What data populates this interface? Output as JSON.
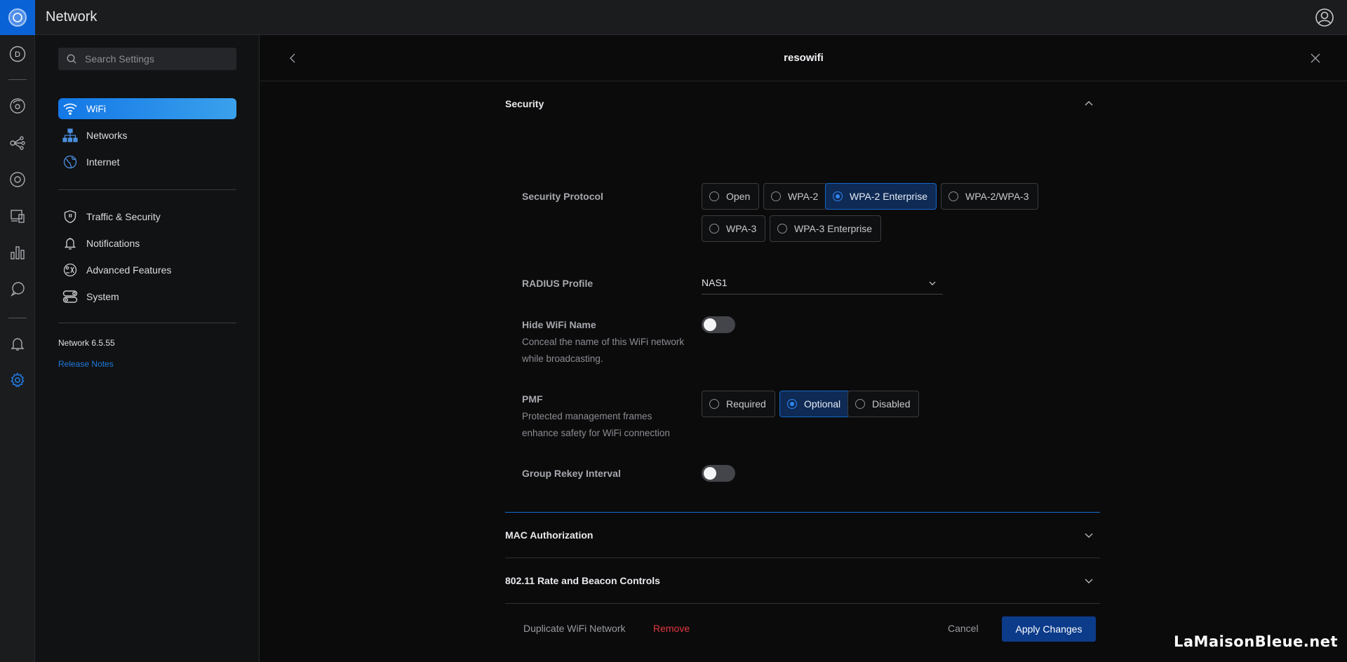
{
  "app": {
    "title": "Network"
  },
  "rail": {
    "items": [
      "dashboard-icon",
      "topology-icon",
      "devices-icon",
      "clients-icon",
      "device-monitor-icon",
      "statistics-icon",
      "insights-icon",
      "alerts-icon",
      "settings-icon"
    ],
    "dashboard_letter": "D"
  },
  "sidebar": {
    "search_placeholder": "Search Settings",
    "items": [
      {
        "label": "WiFi",
        "icon": "wifi-icon",
        "active": true
      },
      {
        "label": "Networks",
        "icon": "networks-icon"
      },
      {
        "label": "Internet",
        "icon": "globe-icon"
      },
      {
        "label": "Traffic & Security",
        "icon": "shield-icon"
      },
      {
        "label": "Notifications",
        "icon": "bell-icon"
      },
      {
        "label": "Advanced Features",
        "icon": "advanced-features-icon"
      },
      {
        "label": "System",
        "icon": "system-icon"
      }
    ],
    "version": "Network 6.5.55",
    "release_notes": "Release Notes"
  },
  "panel": {
    "title": "resowifi",
    "security": {
      "heading": "Security",
      "protocol_label": "Security Protocol",
      "protocol_options": [
        "Open",
        "WPA-2",
        "WPA-2 Enterprise",
        "WPA-2/WPA-3",
        "WPA-3",
        "WPA-3 Enterprise"
      ],
      "protocol_selected": "WPA-2 Enterprise",
      "radius_label": "RADIUS Profile",
      "radius_value": "NAS1",
      "hide_label": "Hide WiFi Name",
      "hide_desc": "Conceal the name of this WiFi network while broadcasting.",
      "hide_enabled": false,
      "pmf_label": "PMF",
      "pmf_desc": "Protected management frames enhance safety for WiFi connection",
      "pmf_options": [
        "Required",
        "Optional",
        "Disabled"
      ],
      "pmf_selected": "Optional",
      "rekey_label": "Group Rekey Interval",
      "rekey_enabled": false
    },
    "mac_heading": "MAC Authorization",
    "rate_heading": "802.11 Rate and Beacon Controls"
  },
  "footer": {
    "duplicate": "Duplicate WiFi Network",
    "remove": "Remove",
    "cancel": "Cancel",
    "apply": "Apply Changes"
  },
  "colors": {
    "accent": "#1377e6",
    "danger": "#e0383e",
    "apply_bg": "#0c3b8a"
  },
  "watermark": "LaMaisonBleue.net"
}
